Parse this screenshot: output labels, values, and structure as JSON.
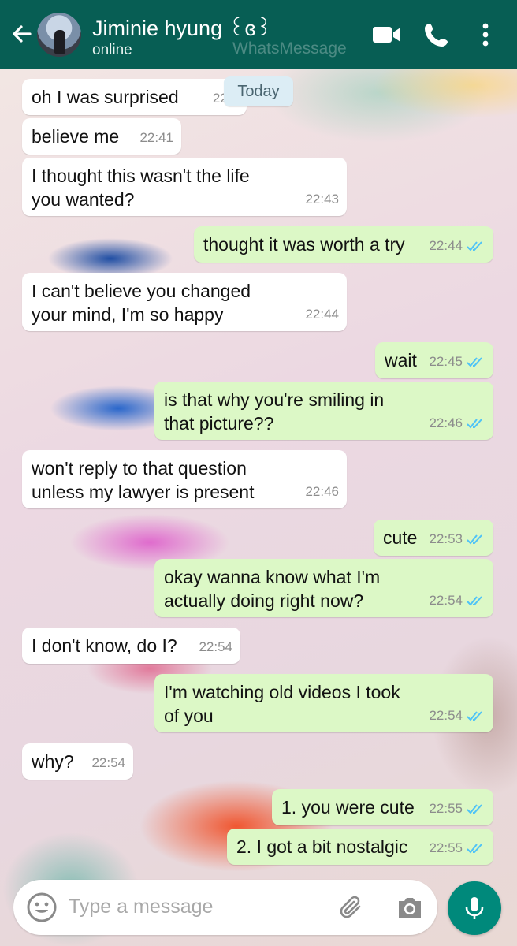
{
  "header": {
    "contact_name": "Jiminie hyung ꒰ɞ꒱",
    "status": "online",
    "watermark": "WhatsMessage",
    "icons": [
      "back-arrow-icon",
      "video-call-icon",
      "voice-call-icon",
      "more-options-icon"
    ]
  },
  "date_chip": "Today",
  "messages": [
    {
      "dir": "in",
      "lines": [
        "oh I was surprised"
      ],
      "time": "22:4"
    },
    {
      "dir": "in",
      "lines": [
        "believe me"
      ],
      "time": "22:41"
    },
    {
      "dir": "in",
      "lines": [
        "I thought this wasn't the life",
        "you wanted?"
      ],
      "time": "22:43"
    },
    {
      "dir": "out",
      "lines": [
        "thought it was worth a try"
      ],
      "time": "22:44"
    },
    {
      "dir": "in",
      "lines": [
        "I can't believe you changed",
        "your mind, I'm so happy"
      ],
      "time": "22:44"
    },
    {
      "dir": "out",
      "lines": [
        "wait"
      ],
      "time": "22:45"
    },
    {
      "dir": "out",
      "lines": [
        "is that why you're smiling in",
        "that picture??"
      ],
      "time": "22:46"
    },
    {
      "dir": "in",
      "lines": [
        "won't reply to that question",
        "unless my lawyer is present"
      ],
      "time": "22:46"
    },
    {
      "dir": "out",
      "lines": [
        "cute"
      ],
      "time": "22:53"
    },
    {
      "dir": "out",
      "lines": [
        "okay wanna know what I'm",
        "actually doing right now?"
      ],
      "time": "22:54"
    },
    {
      "dir": "in",
      "lines": [
        "I don't know, do I?"
      ],
      "time": "22:54"
    },
    {
      "dir": "out",
      "lines": [
        "I'm watching old videos I took",
        "of you"
      ],
      "time": "22:54"
    },
    {
      "dir": "in",
      "lines": [
        "why?"
      ],
      "time": "22:54"
    },
    {
      "dir": "out",
      "lines": [
        "1. you were cute"
      ],
      "time": "22:55"
    },
    {
      "dir": "out",
      "lines": [
        "2. I got a bit nostalgic"
      ],
      "time": "22:55"
    }
  ],
  "composer": {
    "placeholder": "Type a message",
    "icons": [
      "emoji-icon",
      "attach-icon",
      "camera-icon",
      "mic-icon"
    ]
  },
  "colors": {
    "header": "#075e54",
    "outgoing_bubble": "#dcf8c6",
    "incoming_bubble": "#ffffff",
    "read_tick": "#4fc3f7",
    "mic_button": "#00897b"
  }
}
